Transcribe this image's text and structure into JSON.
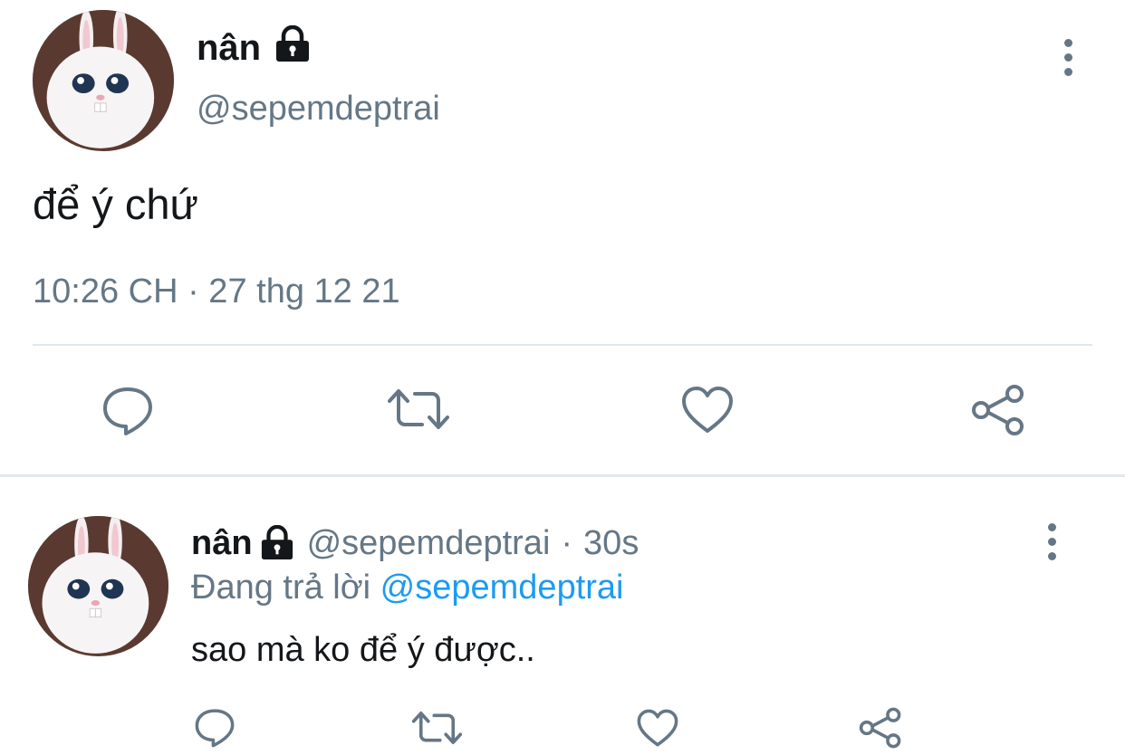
{
  "main_tweet": {
    "display_name": "nân",
    "handle": "@sepemdeptrai",
    "text": "để ý chứ",
    "timestamp": "10:26 CH · 27 thg 12 21",
    "icons": {
      "lock": "lock-icon",
      "more": "more-vertical-icon",
      "reply": "reply-icon",
      "retweet": "retweet-icon",
      "like": "heart-icon",
      "share": "share-icon"
    }
  },
  "reply_tweet": {
    "display_name": "nân",
    "handle": "@sepemdeptrai",
    "separator": "·",
    "time_ago": "30s",
    "replying_to_prefix": "Đang trả lời",
    "replying_to_handle": "@sepemdeptrai",
    "text": "sao mà ko để ý được..",
    "icons": {
      "lock": "lock-icon",
      "more": "more-vertical-icon",
      "reply": "reply-icon",
      "retweet": "retweet-icon",
      "like": "heart-icon",
      "share": "share-icon"
    }
  },
  "colors": {
    "text": "#14171a",
    "muted": "#657786",
    "link": "#1d9bf0",
    "divider": "#e1e8ed"
  }
}
